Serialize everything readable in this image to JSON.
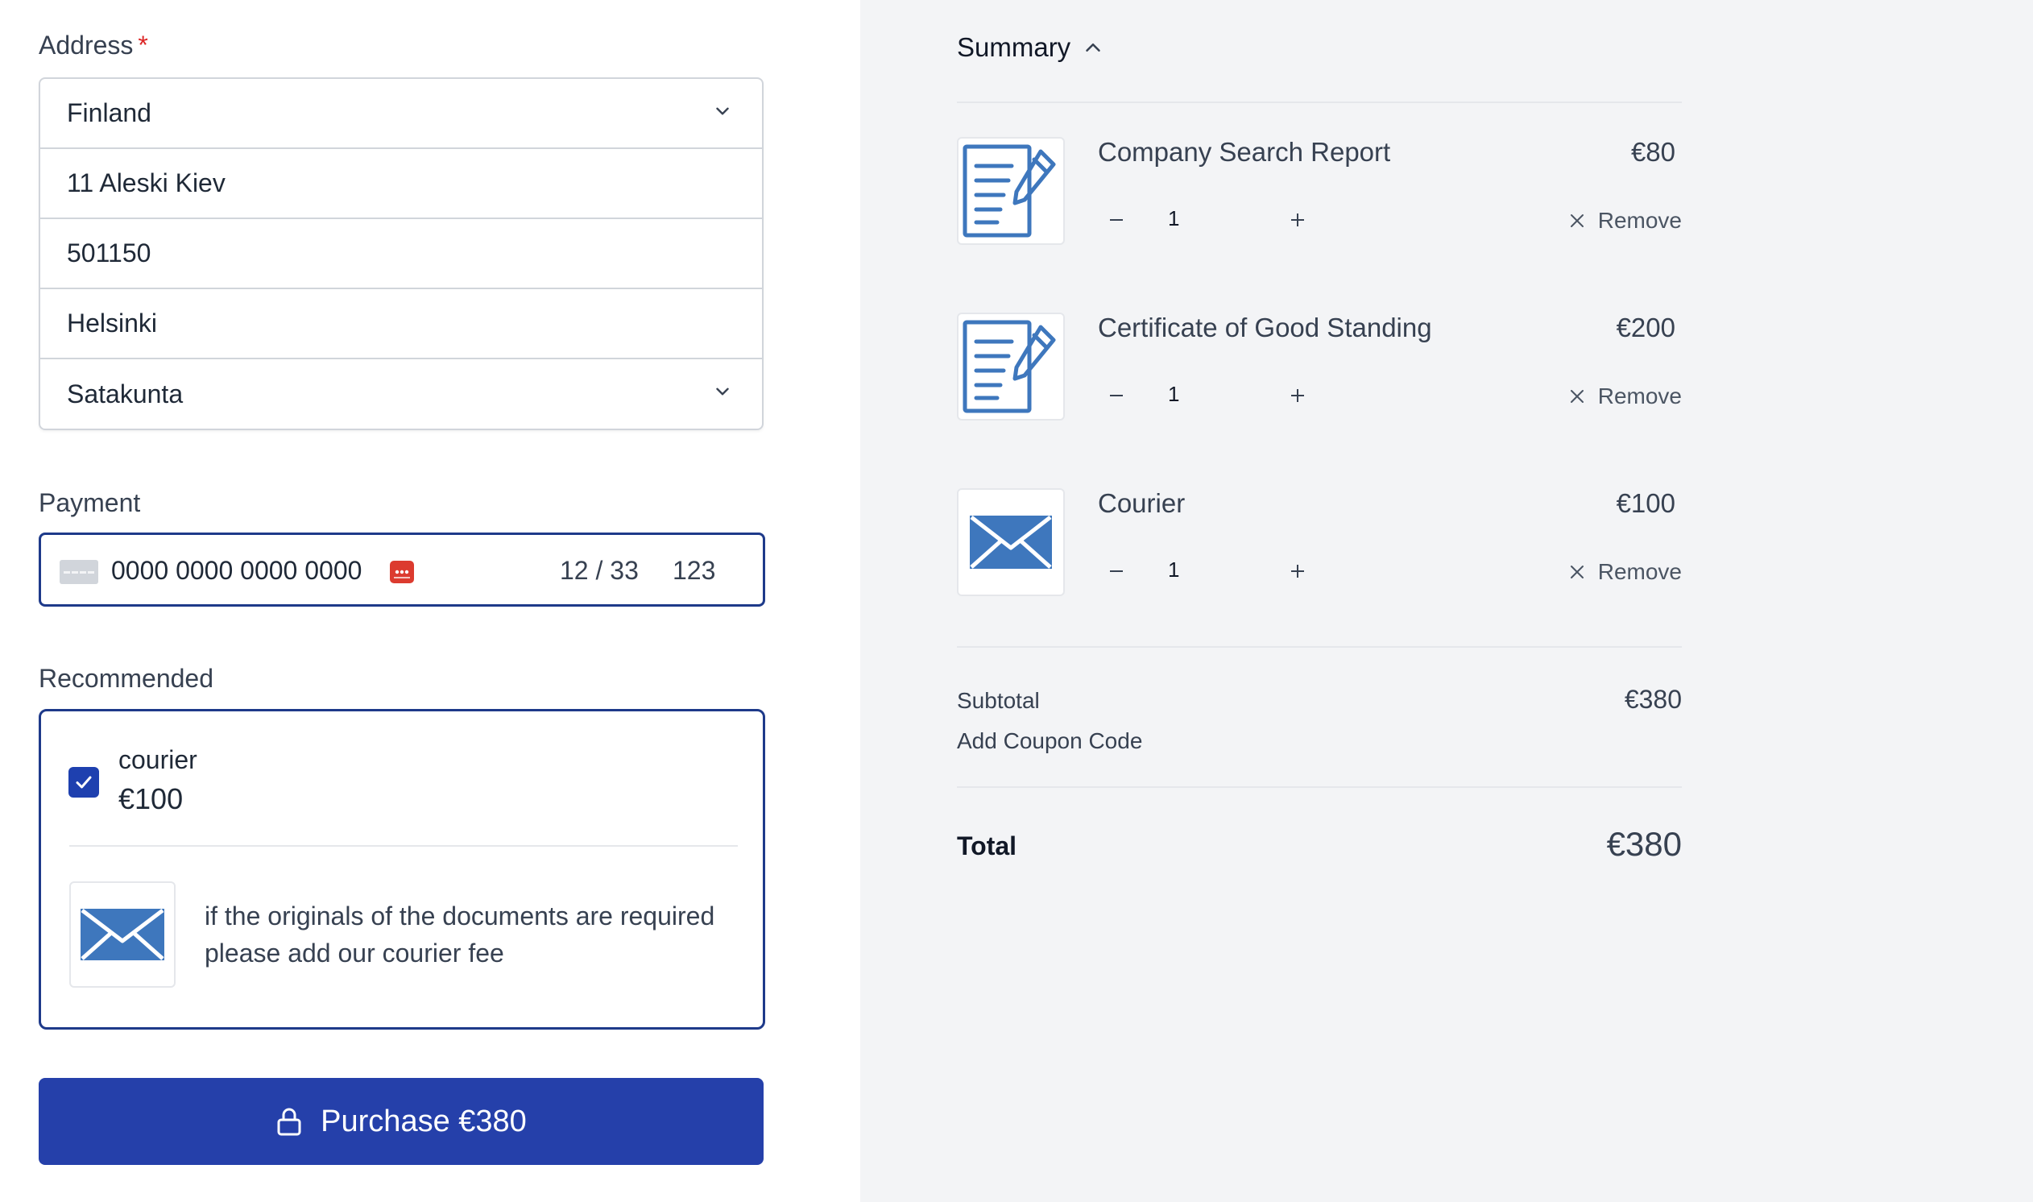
{
  "address": {
    "label": "Address",
    "required_mark": "*",
    "country": "Finland",
    "street": "11 Aleski Kiev",
    "postal_code": "501150",
    "city": "Helsinki",
    "region": "Satakunta"
  },
  "payment": {
    "label": "Payment",
    "card_number": "0000 0000 0000 0000",
    "expiry": "12 / 33",
    "cvc": "123"
  },
  "recommended": {
    "label": "Recommended",
    "title": "courier",
    "price": "€100",
    "checked": true,
    "description": "if the originals of the documents are required please add our courier fee"
  },
  "purchase_button": {
    "label": "Purchase €380"
  },
  "summary": {
    "title": "Summary",
    "items": [
      {
        "name": "Company Search Report",
        "price": "€80",
        "qty": "1",
        "remove_label": "Remove",
        "icon": "document-icon"
      },
      {
        "name": "Certificate of Good Standing",
        "price": "€200",
        "qty": "1",
        "remove_label": "Remove",
        "icon": "document-icon"
      },
      {
        "name": "Courier",
        "price": "€100",
        "qty": "1",
        "remove_label": "Remove",
        "icon": "envelope-icon"
      }
    ],
    "subtotal_label": "Subtotal",
    "subtotal_value": "€380",
    "coupon_label": "Add Coupon Code",
    "total_label": "Total",
    "total_value": "€380"
  },
  "colors": {
    "accent": "#2540aa",
    "focus_border": "#1e3a8a",
    "right_panel_bg": "#f3f4f6",
    "icon_blue": "#3e77bd",
    "required": "#dc2626"
  }
}
